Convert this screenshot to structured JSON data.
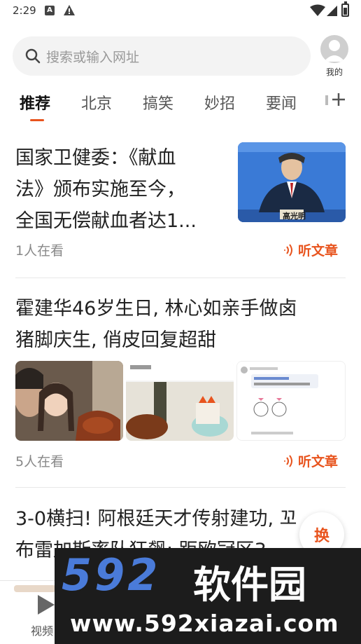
{
  "status_bar": {
    "time": "2:29",
    "notification_icons": [
      "a-icon",
      "warning-icon"
    ],
    "system_icons": [
      "wifi-icon",
      "signal-icon",
      "battery-icon"
    ]
  },
  "search": {
    "placeholder": "搜索或输入网址"
  },
  "profile": {
    "label": "我的"
  },
  "tabs": [
    {
      "label": "推荐",
      "active": true
    },
    {
      "label": "北京",
      "active": false
    },
    {
      "label": "搞笑",
      "active": false
    },
    {
      "label": "妙招",
      "active": false
    },
    {
      "label": "要闻",
      "active": false
    }
  ],
  "articles": [
    {
      "title_lines": [
        "国家卫健委：《献血",
        "法》颁布实施至今，",
        "全国无偿献血者达1..."
      ],
      "views": "1人在看",
      "listen_label": "听文章",
      "image_caption": "高光明"
    },
    {
      "title_lines": [
        "霍建华46岁生日, 林心如亲手做卤",
        "猪脚庆生, 俏皮回复超甜"
      ],
      "views": "5人在看",
      "listen_label": "听文章"
    },
    {
      "title_lines": [
        "3-0横扫! 阿根廷天才传射建功, 꼬",
        "布雷加斯率队狂飙: 距欧冠区3"
      ]
    }
  ],
  "swap_button": {
    "label": "换"
  },
  "bottom_nav": {
    "video_label": "视频"
  },
  "watermark": {
    "logo_number": "592",
    "logo_text": "软件园",
    "url": "www.592xiazai.com"
  },
  "colors": {
    "accent": "#e8541e",
    "watermark_bg": "#1c1c1c",
    "watermark_blue": "#4a7bd9"
  }
}
